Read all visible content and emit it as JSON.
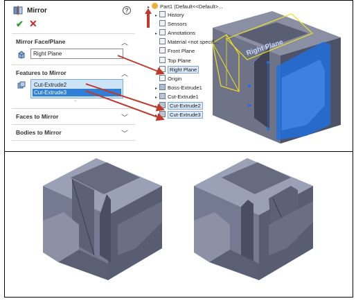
{
  "property_manager": {
    "title": "Mirror",
    "help_glyph": "?",
    "ok_glyph": "✔",
    "cancel_glyph": "✕",
    "mirror_face_plane": {
      "title": "Mirror Face/Plane",
      "value": "Right Plane"
    },
    "features_to_mirror": {
      "title": "Features to Mirror",
      "items": [
        "Cut-Extrude2",
        "Cut-Extrude3"
      ],
      "selected_index": 1
    },
    "faces_to_mirror": {
      "title": "Faces to Mirror"
    },
    "bodies_to_mirror": {
      "title": "Bodies to Mirror"
    }
  },
  "feature_tree": {
    "root": "Part1  (Default<<Default>...",
    "items": [
      {
        "label": "History",
        "icon": "history-icon",
        "expandable": true
      },
      {
        "label": "Sensors",
        "icon": "sensors-icon",
        "expandable": false
      },
      {
        "label": "Annotations",
        "icon": "annotations-icon",
        "expandable": true
      },
      {
        "label": "Material <not specifi...",
        "icon": "material-icon",
        "expandable": false
      },
      {
        "label": "Front Plane",
        "icon": "plane-icon",
        "expandable": false
      },
      {
        "label": "Top Plane",
        "icon": "plane-icon",
        "expandable": false
      },
      {
        "label": "Right Plane",
        "icon": "plane-icon",
        "expandable": false,
        "highlighted": true
      },
      {
        "label": "Origin",
        "icon": "origin-icon",
        "expandable": false
      },
      {
        "label": "Boss-Extrude1",
        "icon": "extrude-icon",
        "expandable": true
      },
      {
        "label": "Cut-Extrude1",
        "icon": "cut-extrude-icon",
        "expandable": true
      },
      {
        "label": "Cut-Extrude2",
        "icon": "cut-extrude-icon",
        "expandable": true,
        "highlighted": true
      },
      {
        "label": "Cut-Extrude3",
        "icon": "cut-extrude-icon",
        "expandable": true,
        "highlighted": true
      }
    ]
  },
  "model": {
    "plane_label": "Right Plane"
  },
  "colors": {
    "accent": "#2f7fd4",
    "selection_bg": "#cde3f7",
    "arrow": "#c0392b",
    "plane_outline": "#f0e020",
    "face_highlight": "#1f6fe0",
    "model_body": "#6e7388"
  }
}
